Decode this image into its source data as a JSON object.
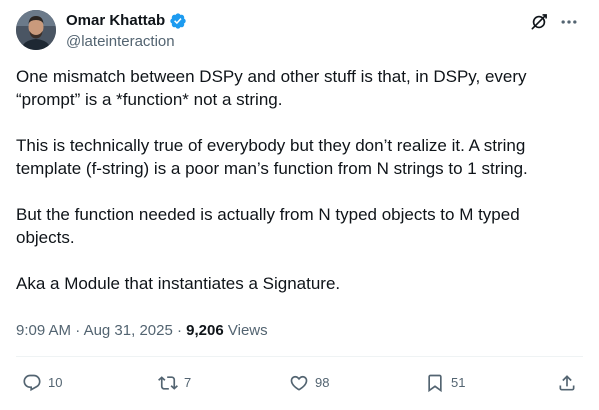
{
  "author": {
    "display_name": "Omar Khattab",
    "handle": "@lateinteraction",
    "verified": true,
    "avatar_icon": "user-avatar"
  },
  "tweet": {
    "paragraphs": [
      "One mismatch between DSPy and other stuff is that, in DSPy, every “prompt” is a *function* not a string.",
      "This is technically true of everybody but they don’t realize it. A string template (f-string) is a poor man’s function from N strings to 1 string.",
      "But the function needed is actually from N typed objects to M typed objects.",
      "Aka a Module that instantiates a Signature."
    ]
  },
  "meta": {
    "time": "9:09 AM",
    "separator": "·",
    "date": "Aug 31, 2025",
    "views_count": "9,206",
    "views_label": "Views"
  },
  "actions": {
    "replies": "10",
    "reposts": "7",
    "likes": "98",
    "bookmarks": "51"
  },
  "colors": {
    "text_primary": "#0f1419",
    "text_secondary": "#536471",
    "verified_blue": "#1d9bf0",
    "divider": "#eff3f4"
  }
}
